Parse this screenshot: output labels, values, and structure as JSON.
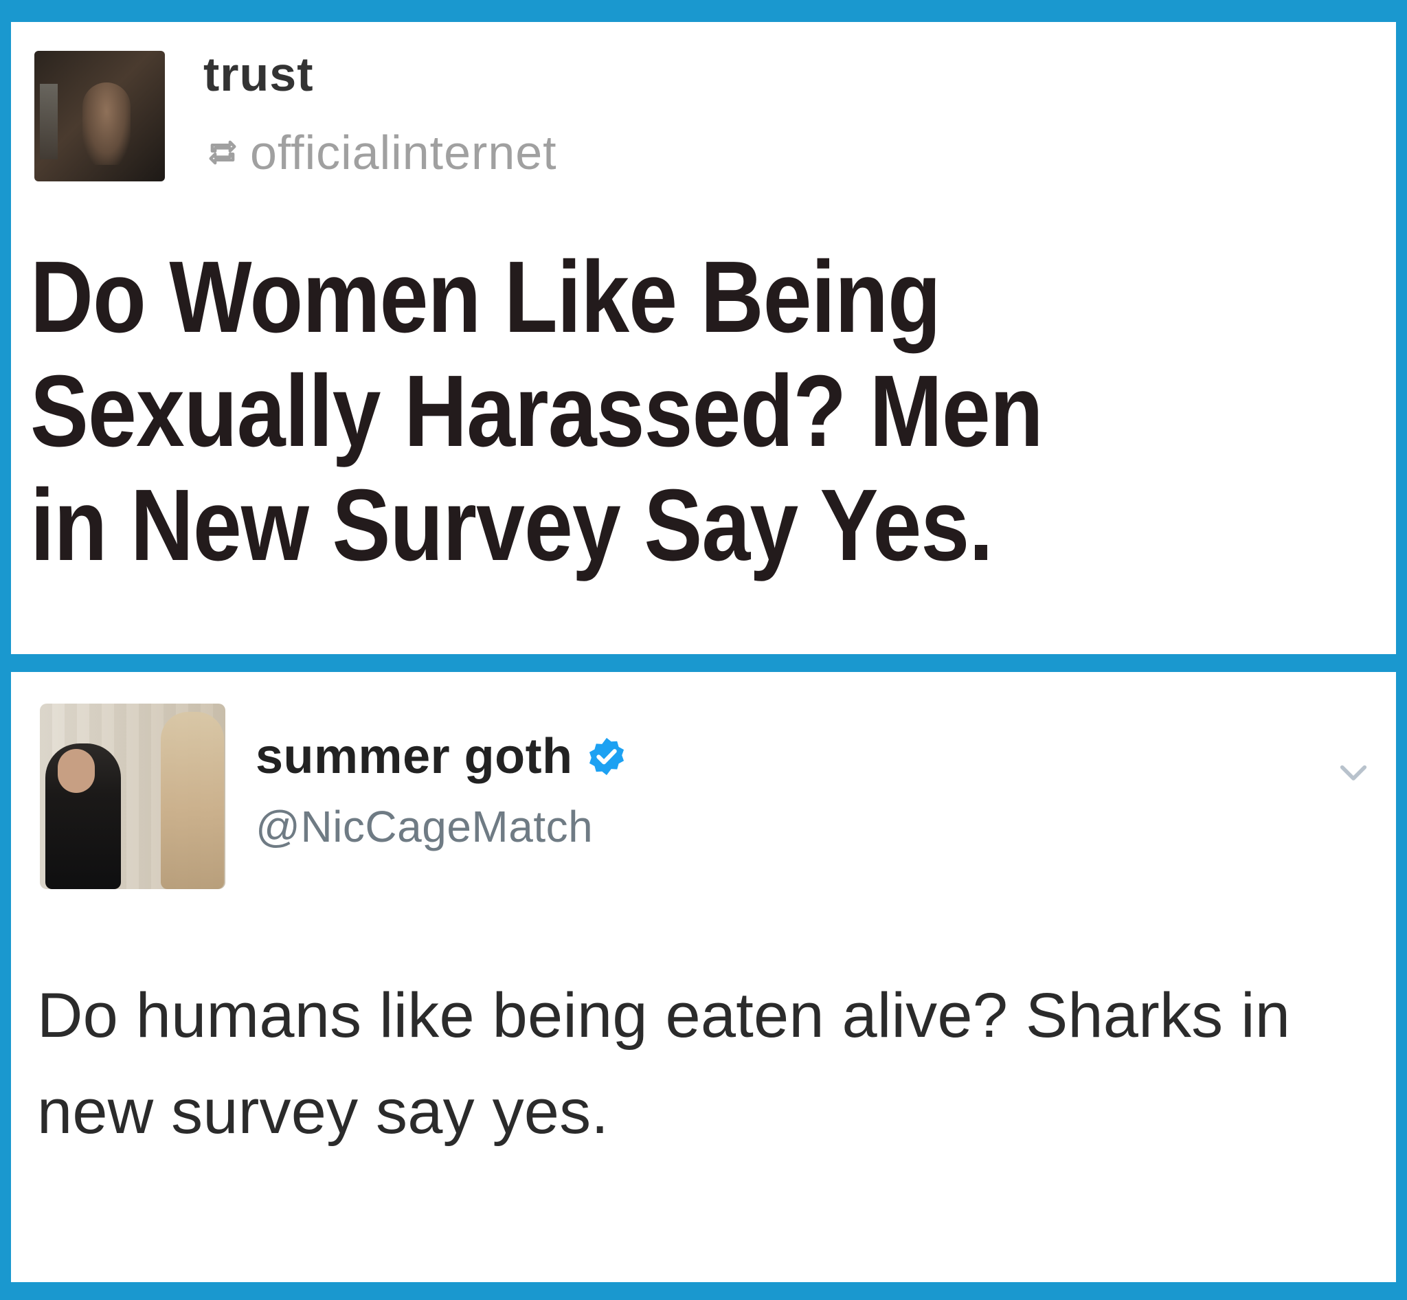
{
  "top_post": {
    "username": "trust",
    "reblogged_from": "officialinternet",
    "headline_lines": [
      "Do Women Like Being",
      "Sexually Harassed? Men",
      "in New Survey Say Yes."
    ]
  },
  "bottom_tweet": {
    "display_name": "summer goth",
    "handle": "@NicCageMatch",
    "text": "Do humans like being eaten alive? Sharks in new survey say yes."
  },
  "colors": {
    "frame_blue": "#1a98cf",
    "verified_blue": "#1da1f2"
  },
  "icons": {
    "reblog": "reblog-icon",
    "verified": "verified-icon",
    "chevron": "chevron-down-icon"
  }
}
